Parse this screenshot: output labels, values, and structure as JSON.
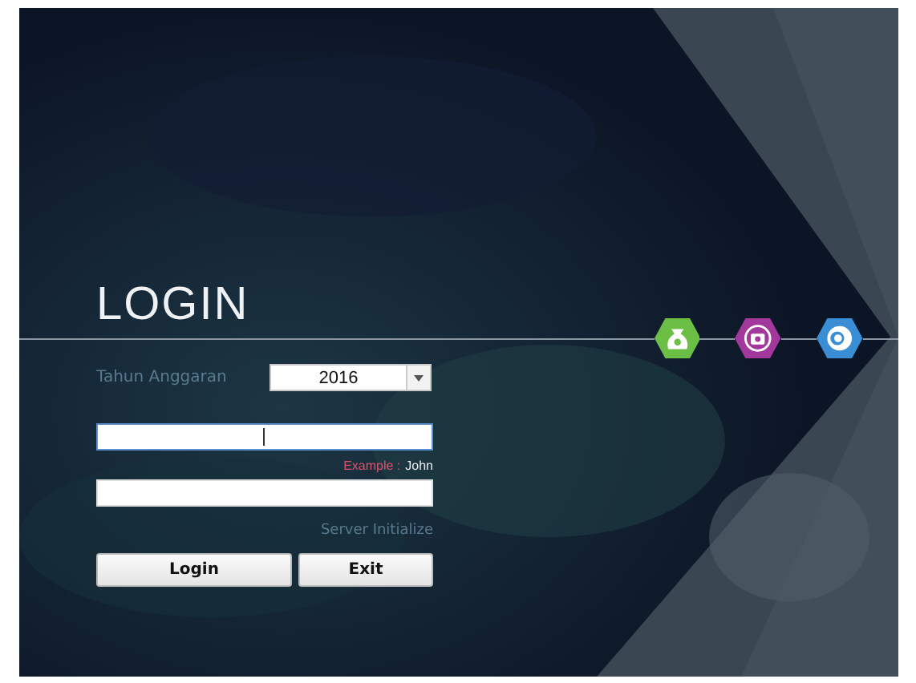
{
  "title": "LOGIN",
  "badges": [
    {
      "kind": "money",
      "color": "#6cbf45"
    },
    {
      "kind": "camera",
      "color": "#a3389c"
    },
    {
      "kind": "globe",
      "color": "#3a8ed6"
    }
  ],
  "year": {
    "label": "Tahun Anggaran",
    "value": "2016"
  },
  "fields": [
    {
      "focused": true
    },
    {
      "focused": false
    }
  ],
  "hint": {
    "label": "Example :",
    "value": "John"
  },
  "status": "Server Initialize",
  "buttons": [
    "Login",
    "Exit"
  ]
}
